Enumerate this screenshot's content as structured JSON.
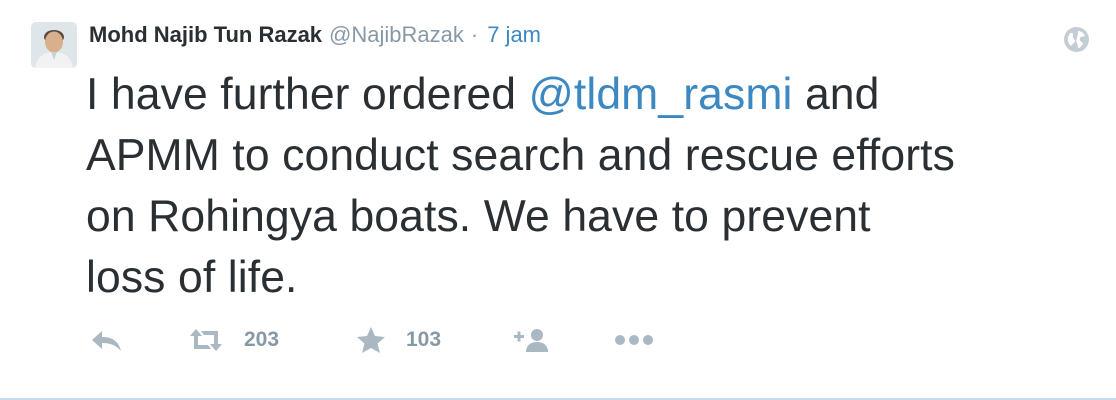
{
  "tweet": {
    "fullname": "Mohd Najib Tun Razak",
    "username": "@NajibRazak",
    "separator": "·",
    "time": "7 jam",
    "text_line1_pre": "I have further ordered ",
    "mention": "@tldm_rasmi",
    "text_line1_post": " and",
    "text_line2": "APMM to conduct search and rescue efforts",
    "text_line3": "on Rohingya boats. We have to prevent",
    "text_line4": "loss of life."
  },
  "actions": {
    "reply_icon": "reply-icon",
    "retweet_icon": "retweet-icon",
    "retweet_count": "203",
    "favorite_icon": "star-icon",
    "favorite_count": "103",
    "follow_icon": "add-user-icon",
    "more_icon": "ellipsis-icon"
  },
  "icons": {
    "globe": "globe-icon"
  },
  "colors": {
    "link": "#3b88c3",
    "muted": "#8899a6",
    "text": "#292f33",
    "icon": "#aab8c2",
    "divider": "#c7d8e6"
  }
}
